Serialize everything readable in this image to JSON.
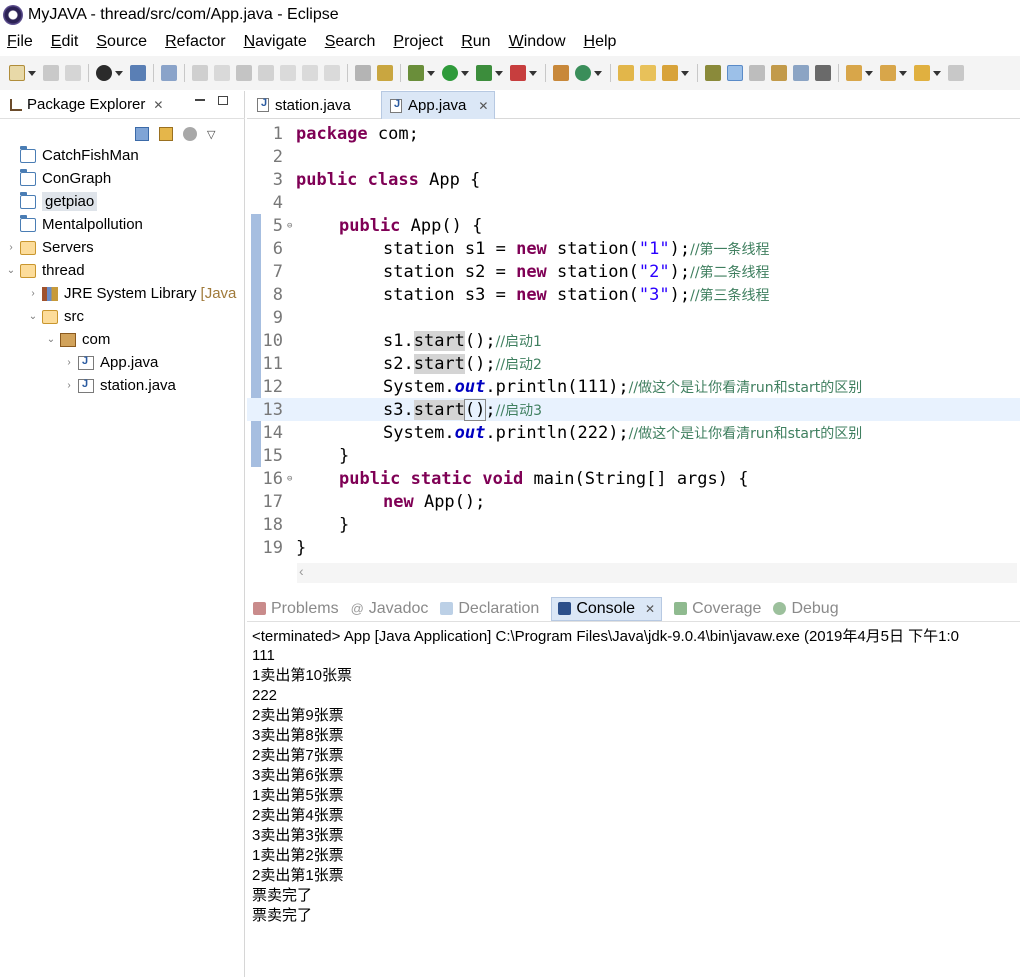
{
  "window": {
    "title": "MyJAVA - thread/src/com/App.java - Eclipse"
  },
  "menu": [
    "File",
    "Edit",
    "Source",
    "Refactor",
    "Navigate",
    "Search",
    "Project",
    "Run",
    "Window",
    "Help"
  ],
  "package_explorer": {
    "tab_label": "Package Explorer",
    "tree": [
      {
        "label": "CatchFishMan",
        "icon": "project-folder-icon",
        "expanded": null
      },
      {
        "label": "ConGraph",
        "icon": "project-folder-icon",
        "expanded": null
      },
      {
        "label": "getpiao",
        "icon": "project-folder-icon",
        "expanded": null,
        "selected": true
      },
      {
        "label": "Mentalpollution",
        "icon": "project-folder-icon",
        "expanded": null
      },
      {
        "label": "Servers",
        "icon": "open-folder-icon",
        "expanded": false
      },
      {
        "label": "thread",
        "icon": "open-folder-icon",
        "expanded": true
      },
      {
        "label": "JRE System Library",
        "suffix": "[Java",
        "icon": "library-icon",
        "expanded": false
      },
      {
        "label": "src",
        "icon": "source-folder-icon",
        "expanded": true
      },
      {
        "label": "com",
        "icon": "package-icon",
        "expanded": true
      },
      {
        "label": "App.java",
        "icon": "java-file-icon",
        "expanded": false
      },
      {
        "label": "station.java",
        "icon": "java-file-icon",
        "expanded": false
      }
    ]
  },
  "editor": {
    "tabs": [
      {
        "label": "station.java",
        "active": false
      },
      {
        "label": "App.java",
        "active": true
      }
    ],
    "current_line": 13,
    "lines": [
      {
        "n": "1",
        "fold": ""
      },
      {
        "n": "2",
        "fold": ""
      },
      {
        "n": "3",
        "fold": ""
      },
      {
        "n": "4",
        "fold": ""
      },
      {
        "n": "5",
        "fold": "⊖"
      },
      {
        "n": "6",
        "fold": ""
      },
      {
        "n": "7",
        "fold": ""
      },
      {
        "n": "8",
        "fold": ""
      },
      {
        "n": "9",
        "fold": ""
      },
      {
        "n": "10",
        "fold": ""
      },
      {
        "n": "11",
        "fold": ""
      },
      {
        "n": "12",
        "fold": ""
      },
      {
        "n": "13",
        "fold": ""
      },
      {
        "n": "14",
        "fold": ""
      },
      {
        "n": "15",
        "fold": ""
      },
      {
        "n": "16",
        "fold": "⊖"
      },
      {
        "n": "17",
        "fold": ""
      },
      {
        "n": "18",
        "fold": ""
      },
      {
        "n": "19",
        "fold": ""
      }
    ],
    "tokens": {
      "package": "package",
      "com": " com;",
      "public": "public",
      "class": "class",
      "App_brace": " App {",
      "ctor_public": "public",
      "ctor_sig": " App() {",
      "station": "station",
      "s1": " s1 = ",
      "s2": " s2 = ",
      "s3": " s3 = ",
      "new": "new",
      "station_call": " station(",
      "arg1": "\"1\"",
      "arg2": "\"2\"",
      "arg3": "\"3\"",
      "close_semi": ");",
      "c1": "//第一条线程",
      "c2": "//第二条线程",
      "c3": "//第三条线程",
      "s1dot": "s1.",
      "s2dot": "s2.",
      "s3dot": "s3.",
      "start": "start",
      "paren_semi": "();",
      "start3_paren": "()",
      "start3_semi": ";",
      "cs1": "//启动1",
      "cs2": "//启动2",
      "cs3": "//启动3",
      "system": "System.",
      "out": "out",
      "println111": ".println(111);",
      "println222": ".println(222);",
      "cdiff": "//做这个是让你看清run和start的区别",
      "brace_close": "}",
      "static": "static",
      "void": "void",
      "main_sig": " main(String[] args) {",
      "new_app": " App();"
    }
  },
  "console": {
    "tabs": [
      {
        "label": "Problems",
        "active": false
      },
      {
        "label": "Javadoc",
        "active": false
      },
      {
        "label": "Declaration",
        "active": false
      },
      {
        "label": "Console",
        "active": true
      },
      {
        "label": "Coverage",
        "active": false
      },
      {
        "label": "Debug",
        "active": false
      }
    ],
    "header": "<terminated> App [Java Application] C:\\Program Files\\Java\\jdk-9.0.4\\bin\\javaw.exe (2019年4月5日 下午1:0",
    "output": [
      "111",
      "1卖出第10张票",
      "222",
      "2卖出第9张票",
      "3卖出第8张票",
      "2卖出第7张票",
      "3卖出第6张票",
      "1卖出第5张票",
      "2卖出第4张票",
      "3卖出第3张票",
      "1卖出第2张票",
      "2卖出第1张票",
      "票卖完了",
      "票卖完了"
    ]
  },
  "colors": {
    "keyword": "#7f0055",
    "string": "#2a00ff",
    "comment": "#3f7f5f",
    "field": "#0000c0",
    "active_tab": "#dbe7f6",
    "current_line": "#e8f2fe"
  }
}
